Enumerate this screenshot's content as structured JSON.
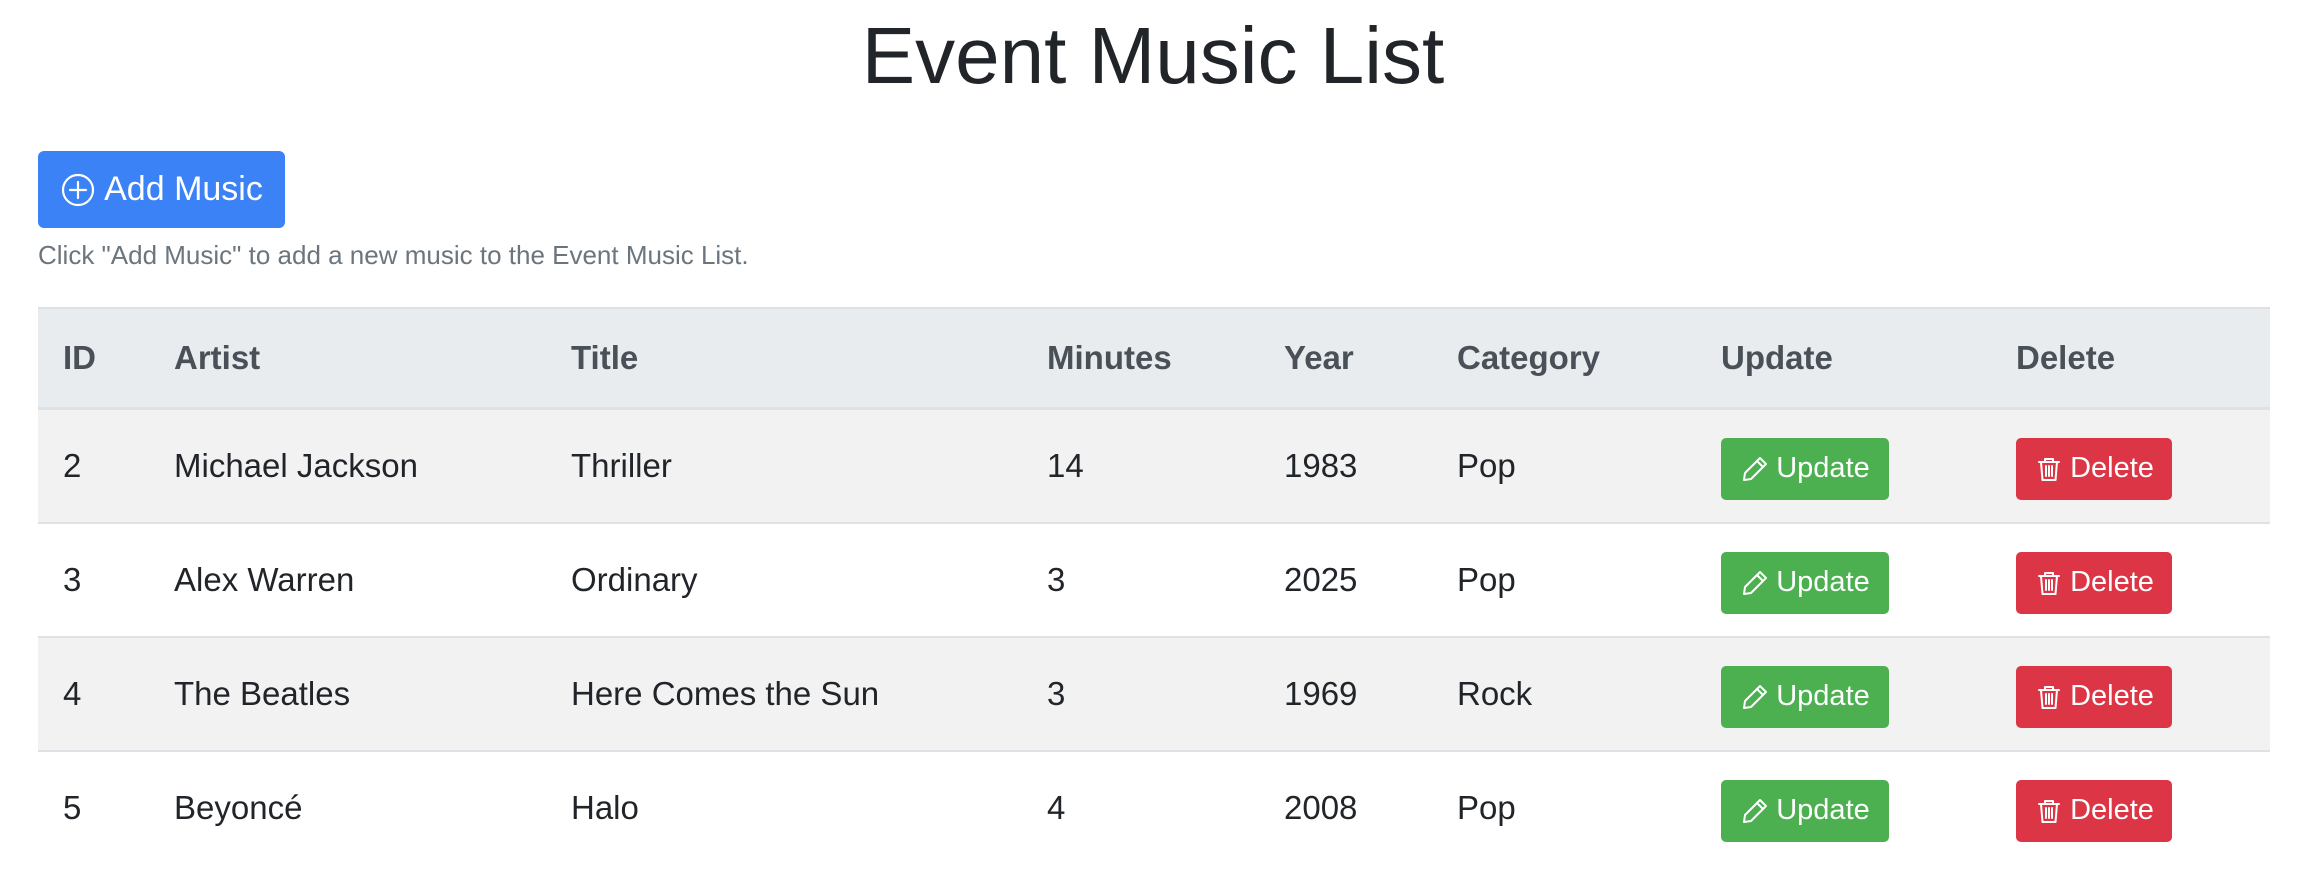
{
  "page": {
    "title": "Event Music List"
  },
  "toolbar": {
    "add_label": "Add Music",
    "add_icon": "plus-circle-icon",
    "hint": "Click \"Add Music\" to add a new music to the Event Music List."
  },
  "table": {
    "headers": [
      "ID",
      "Artist",
      "Title",
      "Minutes",
      "Year",
      "Category",
      "Update",
      "Delete"
    ],
    "rows": [
      {
        "id": "2",
        "artist": "Michael Jackson",
        "title": "Thriller",
        "minutes": "14",
        "year": "1983",
        "category": "Pop",
        "update_label": "Update",
        "delete_label": "Delete"
      },
      {
        "id": "3",
        "artist": "Alex Warren",
        "title": "Ordinary",
        "minutes": "3",
        "year": "2025",
        "category": "Pop",
        "update_label": "Update",
        "delete_label": "Delete"
      },
      {
        "id": "4",
        "artist": "The Beatles",
        "title": "Here Comes the Sun",
        "minutes": "3",
        "year": "1969",
        "category": "Rock",
        "update_label": "Update",
        "delete_label": "Delete"
      },
      {
        "id": "5",
        "artist": "Beyoncé",
        "title": "Halo",
        "minutes": "4",
        "year": "2008",
        "category": "Pop",
        "update_label": "Update",
        "delete_label": "Delete"
      }
    ],
    "update_icon": "pencil-icon",
    "delete_icon": "trash-icon"
  },
  "colors": {
    "primary": "#3b82f6",
    "success": "#4caf50",
    "danger": "#dc3545",
    "header_bg": "#e9ecef",
    "stripe_bg": "#f2f2f3"
  }
}
